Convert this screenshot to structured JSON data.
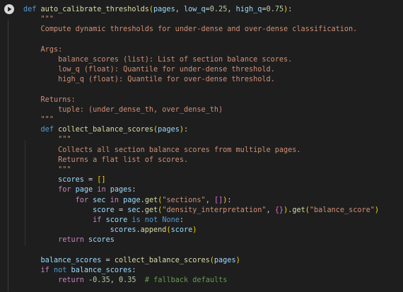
{
  "editor": {
    "run_button_label": "Run cell",
    "lines": [
      [
        [
          "kw",
          "def"
        ],
        [
          "pl",
          " "
        ],
        [
          "fn",
          "auto_calibrate_thresholds"
        ],
        [
          "br1",
          "("
        ],
        [
          "var",
          "pages"
        ],
        [
          "pl",
          ", "
        ],
        [
          "var",
          "low_q"
        ],
        [
          "pl",
          "="
        ],
        [
          "num",
          "0.25"
        ],
        [
          "pl",
          ", "
        ],
        [
          "var",
          "high_q"
        ],
        [
          "pl",
          "="
        ],
        [
          "num",
          "0.75"
        ],
        [
          "br1",
          ")"
        ],
        [
          "pl",
          ":"
        ]
      ],
      [
        [
          "pl",
          "    "
        ],
        [
          "str",
          "\"\"\""
        ]
      ],
      [
        [
          "pl",
          "    "
        ],
        [
          "str",
          "Compute dynamic thresholds for under-dense and over-dense classification."
        ]
      ],
      [],
      [
        [
          "pl",
          "    "
        ],
        [
          "str",
          "Args:"
        ]
      ],
      [
        [
          "pl",
          "        "
        ],
        [
          "str",
          "balance_scores (list): List of section balance scores."
        ]
      ],
      [
        [
          "pl",
          "        "
        ],
        [
          "str",
          "low_q (float): Quantile for under-dense threshold."
        ]
      ],
      [
        [
          "pl",
          "        "
        ],
        [
          "str",
          "high_q (float): Quantile for over-dense threshold."
        ]
      ],
      [],
      [
        [
          "pl",
          "    "
        ],
        [
          "str",
          "Returns:"
        ]
      ],
      [
        [
          "pl",
          "        "
        ],
        [
          "str",
          "tuple: (under_dense_th, over_dense_th)"
        ]
      ],
      [
        [
          "pl",
          "    "
        ],
        [
          "str",
          "\"\"\""
        ]
      ],
      [
        [
          "pl",
          "    "
        ],
        [
          "kw",
          "def"
        ],
        [
          "pl",
          " "
        ],
        [
          "fn",
          "collect_balance_scores"
        ],
        [
          "br1",
          "("
        ],
        [
          "var",
          "pages"
        ],
        [
          "br1",
          ")"
        ],
        [
          "pl",
          ":"
        ]
      ],
      [
        [
          "pl",
          "        "
        ],
        [
          "str",
          "\"\"\""
        ]
      ],
      [
        [
          "pl",
          "        "
        ],
        [
          "str",
          "Collects all section balance scores from multiple pages."
        ]
      ],
      [
        [
          "pl",
          "        "
        ],
        [
          "str",
          "Returns a flat list of scores."
        ]
      ],
      [
        [
          "pl",
          "        "
        ],
        [
          "str",
          "\"\"\""
        ]
      ],
      [
        [
          "pl",
          "        "
        ],
        [
          "var",
          "scores"
        ],
        [
          "pl",
          " = "
        ],
        [
          "br1",
          "[]"
        ]
      ],
      [
        [
          "pl",
          "        "
        ],
        [
          "ctl",
          "for"
        ],
        [
          "pl",
          " "
        ],
        [
          "var",
          "page"
        ],
        [
          "pl",
          " "
        ],
        [
          "ctl",
          "in"
        ],
        [
          "pl",
          " "
        ],
        [
          "var",
          "pages"
        ],
        [
          "pl",
          ":"
        ]
      ],
      [
        [
          "pl",
          "            "
        ],
        [
          "ctl",
          "for"
        ],
        [
          "pl",
          " "
        ],
        [
          "var",
          "sec"
        ],
        [
          "pl",
          " "
        ],
        [
          "ctl",
          "in"
        ],
        [
          "pl",
          " "
        ],
        [
          "var",
          "page"
        ],
        [
          "pl",
          "."
        ],
        [
          "fn",
          "get"
        ],
        [
          "br1",
          "("
        ],
        [
          "str",
          "\"sections\""
        ],
        [
          "pl",
          ", "
        ],
        [
          "br2",
          "[]"
        ],
        [
          "br1",
          ")"
        ],
        [
          "pl",
          ":"
        ]
      ],
      [
        [
          "pl",
          "                "
        ],
        [
          "var",
          "score"
        ],
        [
          "pl",
          " = "
        ],
        [
          "var",
          "sec"
        ],
        [
          "pl",
          "."
        ],
        [
          "fn",
          "get"
        ],
        [
          "br1",
          "("
        ],
        [
          "str",
          "\"density_interpretation\""
        ],
        [
          "pl",
          ", "
        ],
        [
          "br2",
          "{}"
        ],
        [
          "br1",
          ")"
        ],
        [
          "pl",
          "."
        ],
        [
          "fn",
          "get"
        ],
        [
          "br1",
          "("
        ],
        [
          "str",
          "\"balance_score\""
        ],
        [
          "br1",
          ")"
        ]
      ],
      [
        [
          "pl",
          "                "
        ],
        [
          "ctl",
          "if"
        ],
        [
          "pl",
          " "
        ],
        [
          "var",
          "score"
        ],
        [
          "pl",
          " "
        ],
        [
          "kw",
          "is"
        ],
        [
          "pl",
          " "
        ],
        [
          "kw",
          "not"
        ],
        [
          "pl",
          " "
        ],
        [
          "kw",
          "None"
        ],
        [
          "pl",
          ":"
        ]
      ],
      [
        [
          "pl",
          "                    "
        ],
        [
          "var",
          "scores"
        ],
        [
          "pl",
          "."
        ],
        [
          "fn",
          "append"
        ],
        [
          "br1",
          "("
        ],
        [
          "var",
          "score"
        ],
        [
          "br1",
          ")"
        ]
      ],
      [
        [
          "pl",
          "        "
        ],
        [
          "ctl",
          "return"
        ],
        [
          "pl",
          " "
        ],
        [
          "var",
          "scores"
        ]
      ],
      [],
      [
        [
          "pl",
          "    "
        ],
        [
          "var",
          "balance_scores"
        ],
        [
          "pl",
          " = "
        ],
        [
          "fn",
          "collect_balance_scores"
        ],
        [
          "br1",
          "("
        ],
        [
          "var",
          "pages"
        ],
        [
          "br1",
          ")"
        ]
      ],
      [
        [
          "pl",
          "    "
        ],
        [
          "ctl",
          "if"
        ],
        [
          "pl",
          " "
        ],
        [
          "kw",
          "not"
        ],
        [
          "pl",
          " "
        ],
        [
          "var",
          "balance_scores"
        ],
        [
          "pl",
          ":"
        ]
      ],
      [
        [
          "pl",
          "        "
        ],
        [
          "ctl",
          "return"
        ],
        [
          "pl",
          " -"
        ],
        [
          "num",
          "0.35"
        ],
        [
          "pl",
          ", "
        ],
        [
          "num",
          "0.35"
        ],
        [
          "pl",
          "  "
        ],
        [
          "cmt",
          "# fallback defaults"
        ]
      ]
    ]
  }
}
